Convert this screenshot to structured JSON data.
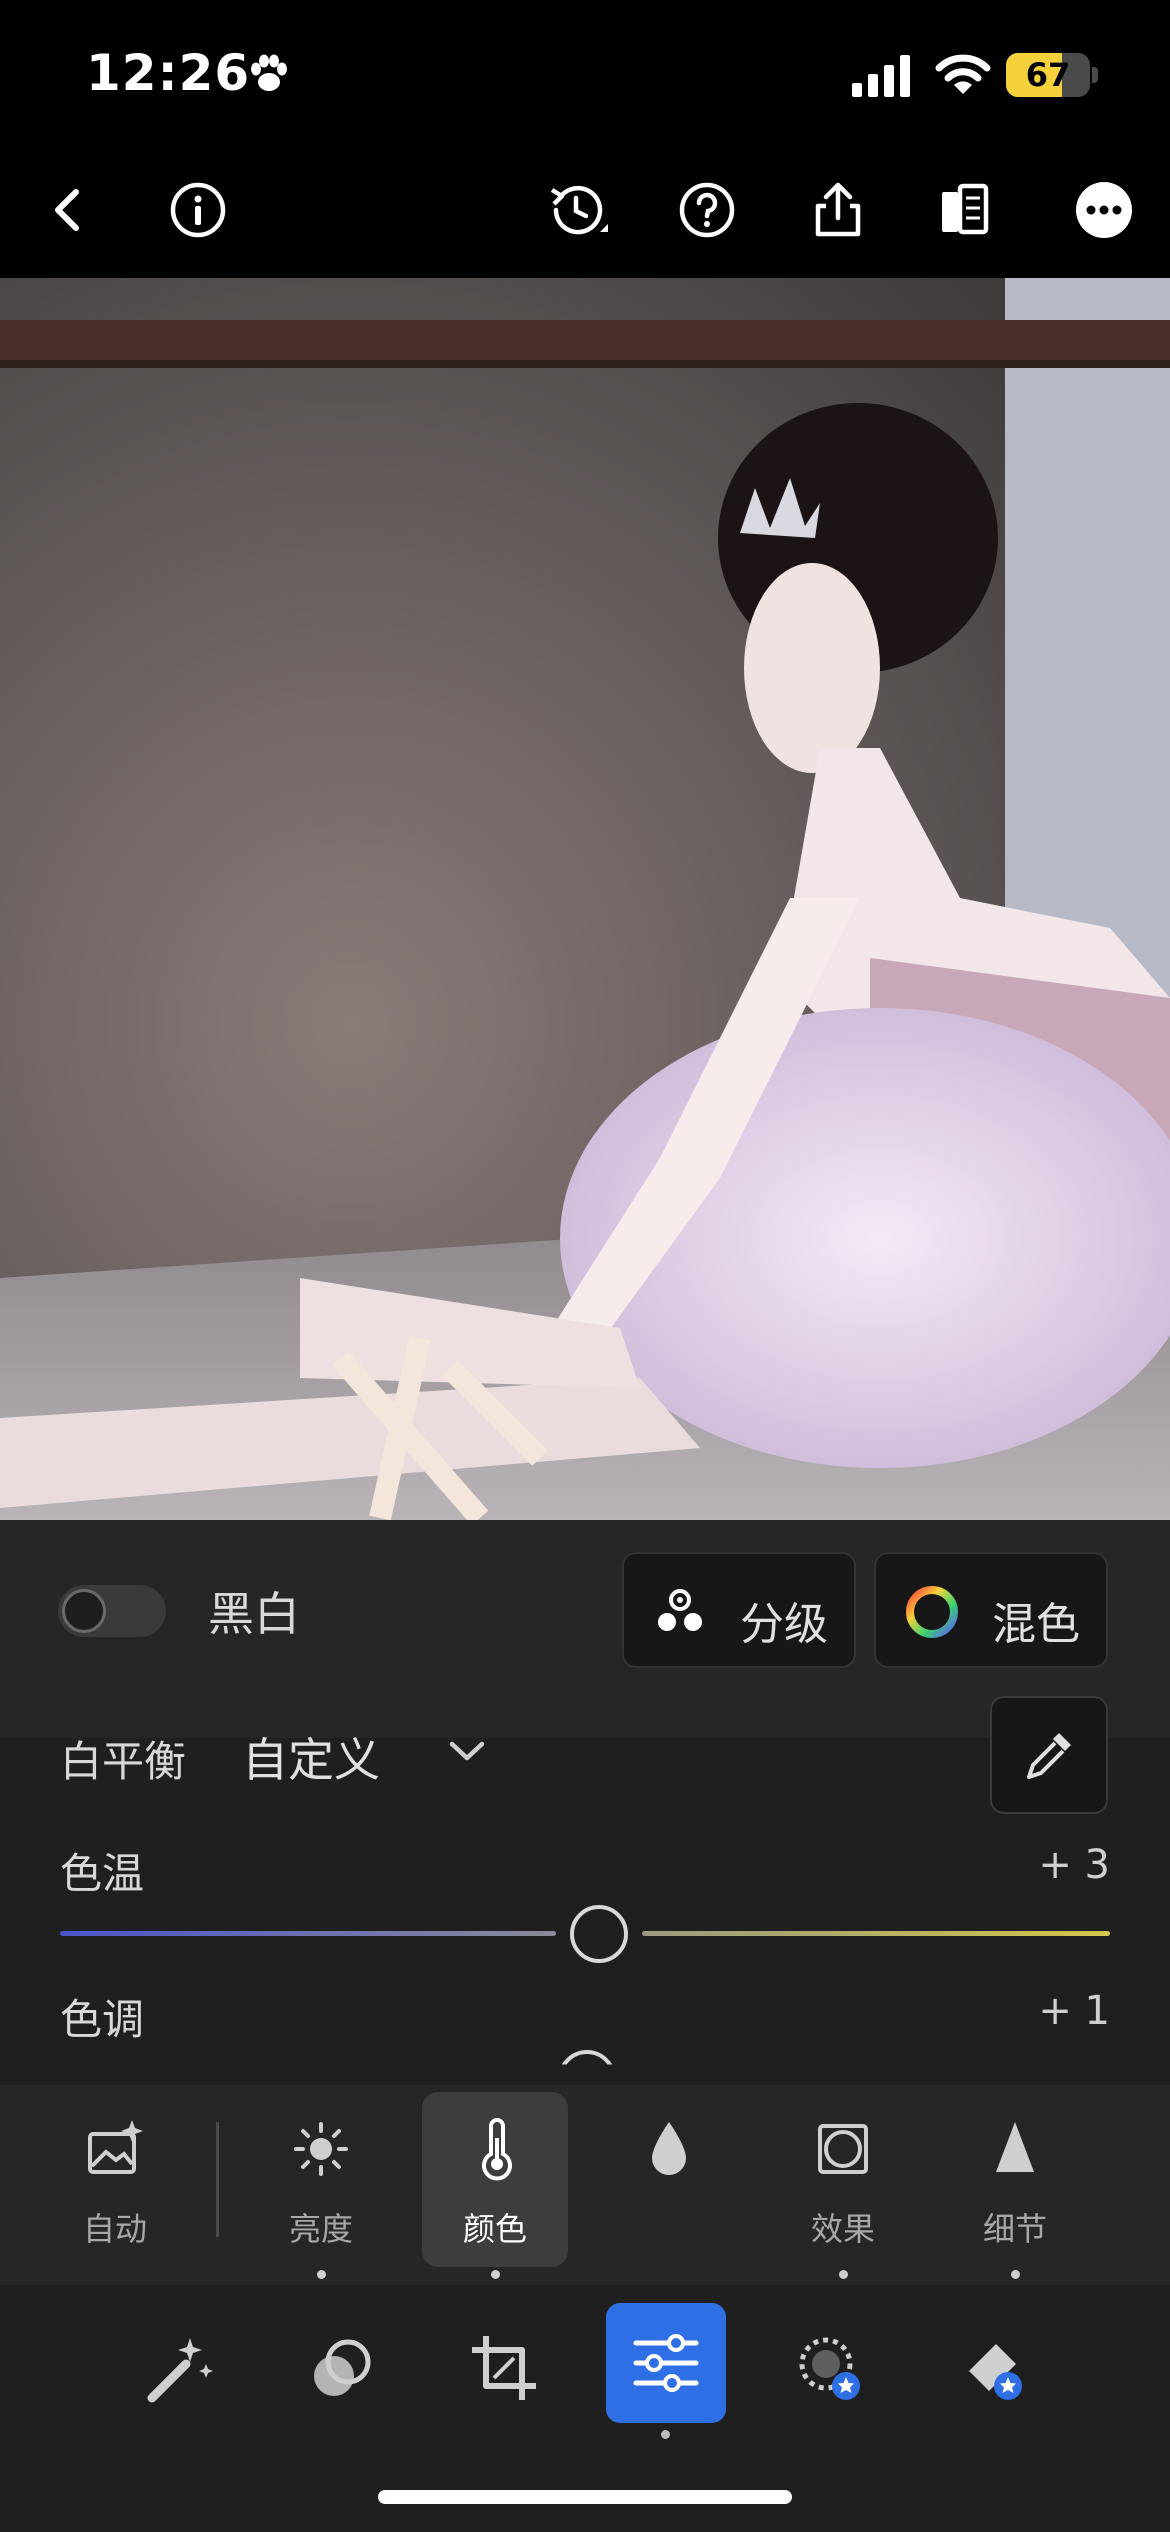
{
  "status_bar": {
    "time": "12:26",
    "battery": "67",
    "battery_level": 0.67,
    "battery_color": "#f5d23c"
  },
  "top_toolbar": {
    "icons": [
      "back-icon",
      "info-icon",
      "history-icon",
      "help-icon",
      "share-icon",
      "compare-icon",
      "more-icon"
    ]
  },
  "photo": {
    "description_icon": "photo-preview"
  },
  "color_panel": {
    "bw_label": "黑白",
    "grading_label": "分级",
    "mix_label": "混色",
    "white_balance_label": "白平衡",
    "white_balance_value": "自定义",
    "temperature_label": "色温",
    "temperature_value": "+ 3",
    "tint_label": "色调",
    "tint_value": "+ 1"
  },
  "tools": [
    {
      "label": "自动",
      "icon": "auto-icon"
    },
    {
      "label": "亮度",
      "icon": "light-icon"
    },
    {
      "label": "颜色",
      "icon": "color-icon",
      "active": true
    },
    {
      "label": "",
      "icon": "drop-icon"
    },
    {
      "label": "效果",
      "icon": "effects-icon"
    },
    {
      "label": "细节",
      "icon": "detail-icon"
    }
  ],
  "bottom_bar": {
    "icons": [
      "presets-icon",
      "masking-icon",
      "crop-icon",
      "edit-icon",
      "selective-icon",
      "healing-icon"
    ],
    "accent": "#2f6fe5"
  }
}
